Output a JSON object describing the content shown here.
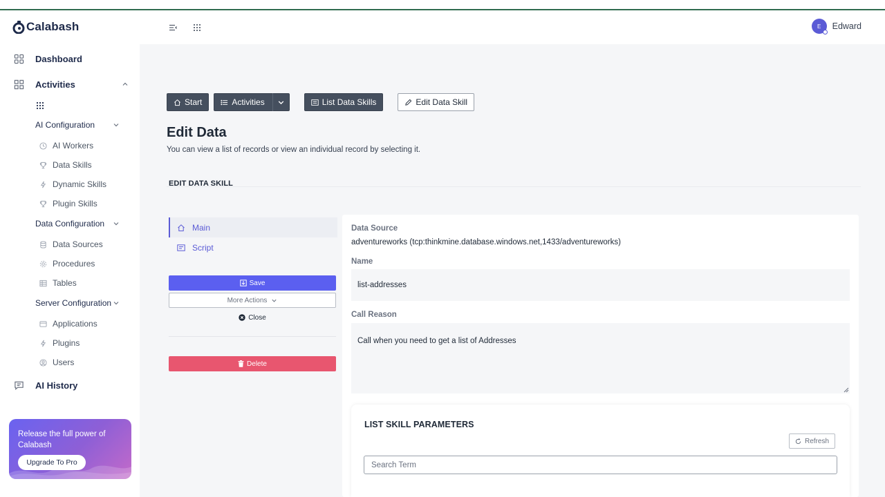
{
  "app": {
    "name": "Calabash"
  },
  "sidebar": {
    "dashboard": "Dashboard",
    "activities": "Activities",
    "ai_config": {
      "label": "AI Configuration",
      "items": [
        "AI Workers",
        "Data Skills",
        "Dynamic Skills",
        "Plugin Skills"
      ]
    },
    "data_config": {
      "label": "Data Configuration",
      "items": [
        "Data Sources",
        "Procedures",
        "Tables"
      ]
    },
    "server_config": {
      "label": "Server Configuration",
      "items": [
        "Applications",
        "Plugins",
        "Users"
      ]
    },
    "ai_history": "AI History",
    "promo": {
      "text": "Release the full power of Calabash",
      "button": "Upgrade To Pro"
    }
  },
  "header": {
    "user_name": "Edward",
    "avatar_initial": "E"
  },
  "breadcrumbs": {
    "start": "Start",
    "activities": "Activities",
    "list": "List Data Skills",
    "edit": "Edit Data Skill"
  },
  "page": {
    "title": "Edit Data",
    "subtitle": "You can view a list of records or view an individual record by selecting it.",
    "section_title": "EDIT DATA SKILL"
  },
  "tabs": {
    "main": "Main",
    "script": "Script"
  },
  "actions": {
    "save": "Save",
    "more": "More Actions",
    "close": "Close",
    "delete": "Delete"
  },
  "form": {
    "data_source_label": "Data Source",
    "data_source_value": "adventureworks (tcp:thinkmine.database.windows.net,1433/adventureworks)",
    "name_label": "Name",
    "name_value": "list-addresses",
    "call_reason_label": "Call Reason",
    "call_reason_value": "Call when you need to get a list of Addresses"
  },
  "params": {
    "title": "LIST SKILL PARAMETERS",
    "refresh": "Refresh",
    "search_placeholder": "Search Term"
  },
  "colors": {
    "accent": "#5b5ff0",
    "danger": "#e8566f",
    "dark_button": "#454f5e",
    "nav_text": "#1e2a4a"
  }
}
